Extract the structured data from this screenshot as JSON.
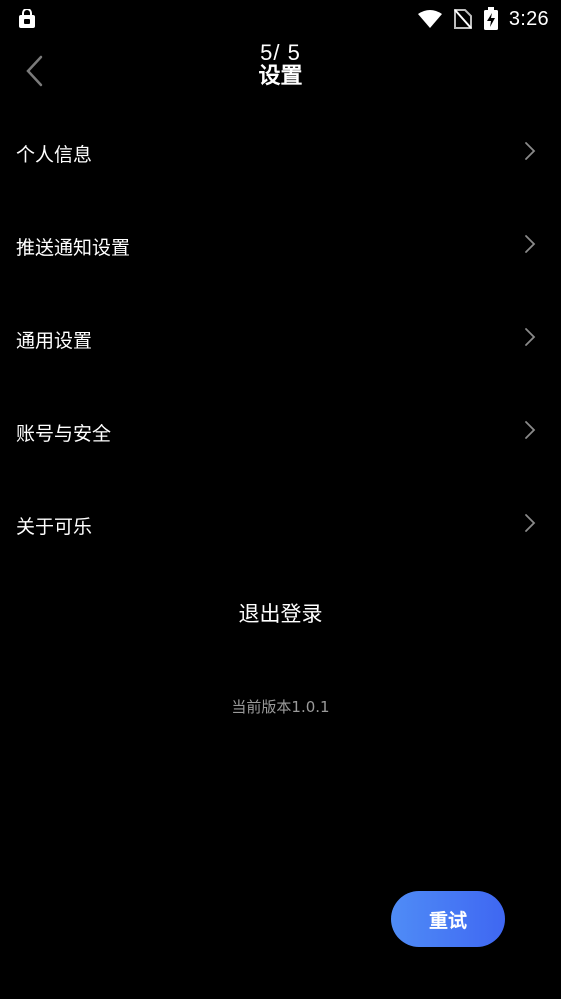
{
  "status_bar": {
    "time": "3:26",
    "icons": [
      "lock-badge-icon",
      "wifi-icon",
      "no-signal-icon",
      "battery-charging-icon"
    ]
  },
  "header": {
    "page_counter": "5/ 5",
    "title": "设置",
    "back_icon": "chevron-left-icon"
  },
  "menu": {
    "items": [
      {
        "label": "个人信息",
        "icon": "chevron-right-icon"
      },
      {
        "label": "推送通知设置",
        "icon": "chevron-right-icon"
      },
      {
        "label": "通用设置",
        "icon": "chevron-right-icon"
      },
      {
        "label": "账号与安全",
        "icon": "chevron-right-icon"
      },
      {
        "label": "关于可乐",
        "icon": "chevron-right-icon"
      }
    ]
  },
  "logout_label": "退出登录",
  "version_text": "当前版本1.0.1",
  "retry_label": "重试",
  "colors": {
    "background": "#000000",
    "text": "#ffffff",
    "muted": "#9a9a9a",
    "accent_start": "#4f8cf6",
    "accent_end": "#3f67f2"
  }
}
